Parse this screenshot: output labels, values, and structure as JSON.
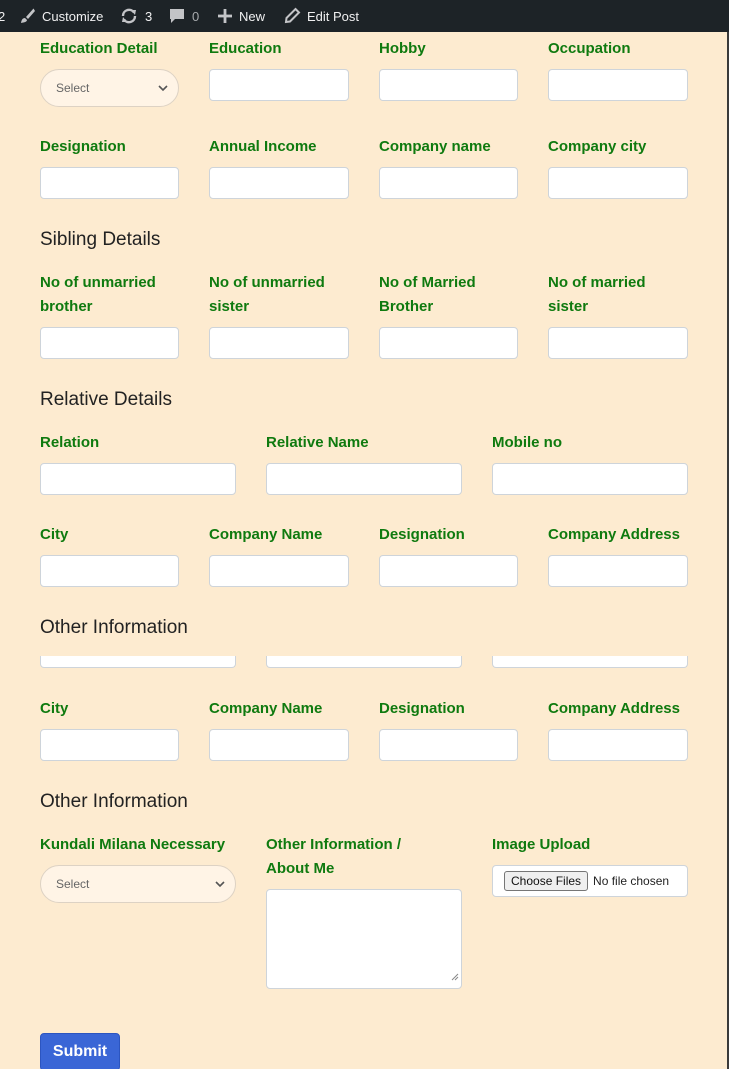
{
  "adminbar": {
    "edge_text": "2",
    "customize": "Customize",
    "updates_count": "3",
    "comments_count": "0",
    "new": "New",
    "edit_post": "Edit Post"
  },
  "education": {
    "education_detail_label": "Education Detail",
    "education_detail_value": "Select",
    "education_label": "Education",
    "hobby_label": "Hobby",
    "occupation_label": "Occupation",
    "designation_label": "Designation",
    "annual_income_label": "Annual Income",
    "company_name_label": "Company name",
    "company_city_label": "Company city"
  },
  "sibling": {
    "heading": "Sibling Details",
    "unmarried_brother_1": "No of unmarried",
    "unmarried_brother_2": "brother",
    "unmarried_sister_1": "No of unmarried",
    "unmarried_sister_2": "sister",
    "married_brother_1": "No of Married",
    "married_brother_2": "Brother",
    "married_sister_1": "No of married",
    "married_sister_2": "sister"
  },
  "relative": {
    "heading": "Relative Details",
    "relation_label": "Relation",
    "relative_name_label": "Relative Name",
    "mobile_label": "Mobile no",
    "city_label": "City",
    "company_name_label": "Company Name",
    "designation_label": "Designation",
    "company_address_label": "Company Address"
  },
  "other_dup": {
    "heading": "Other Information",
    "city_label": "City",
    "company_name_label": "Company Name",
    "designation_label": "Designation",
    "company_address_label": "Company Address"
  },
  "other": {
    "heading": "Other Information",
    "kundali_label": "Kundali Milana Necessary",
    "kundali_value": "Select",
    "about_label_1": "Other Information /",
    "about_label_2": "About Me",
    "image_label": "Image Upload",
    "choose_files": "Choose Files",
    "no_file": "No file chosen"
  },
  "submit_label": "Submit"
}
